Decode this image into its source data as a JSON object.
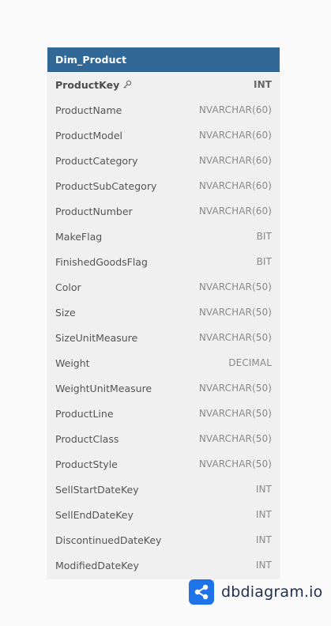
{
  "table": {
    "name": "Dim_Product",
    "fields": [
      {
        "name": "ProductKey",
        "type": "INT",
        "primary_key": true
      },
      {
        "name": "ProductName",
        "type": "NVARCHAR(60)"
      },
      {
        "name": "ProductModel",
        "type": "NVARCHAR(60)"
      },
      {
        "name": "ProductCategory",
        "type": "NVARCHAR(60)"
      },
      {
        "name": "ProductSubCategory",
        "type": "NVARCHAR(60)"
      },
      {
        "name": "ProductNumber",
        "type": "NVARCHAR(60)"
      },
      {
        "name": "MakeFlag",
        "type": "BIT"
      },
      {
        "name": "FinishedGoodsFlag",
        "type": "BIT"
      },
      {
        "name": "Color",
        "type": "NVARCHAR(50)"
      },
      {
        "name": "Size",
        "type": "NVARCHAR(50)"
      },
      {
        "name": "SizeUnitMeasure",
        "type": "NVARCHAR(50)"
      },
      {
        "name": "Weight",
        "type": "DECIMAL"
      },
      {
        "name": "WeightUnitMeasure",
        "type": "NVARCHAR(50)"
      },
      {
        "name": "ProductLine",
        "type": "NVARCHAR(50)"
      },
      {
        "name": "ProductClass",
        "type": "NVARCHAR(50)"
      },
      {
        "name": "ProductStyle",
        "type": "NVARCHAR(50)"
      },
      {
        "name": "SellStartDateKey",
        "type": "INT"
      },
      {
        "name": "SellEndDateKey",
        "type": "INT"
      },
      {
        "name": "DiscontinuedDateKey",
        "type": "INT"
      },
      {
        "name": "ModifiedDateKey",
        "type": "INT"
      }
    ]
  },
  "brand": {
    "name": "dbdiagram.io",
    "logo_icon": "share-nodes-icon"
  },
  "colors": {
    "header_bg": "#316896",
    "row_bg": "#f0f0f0",
    "brand_blue": "#1f73e8"
  }
}
